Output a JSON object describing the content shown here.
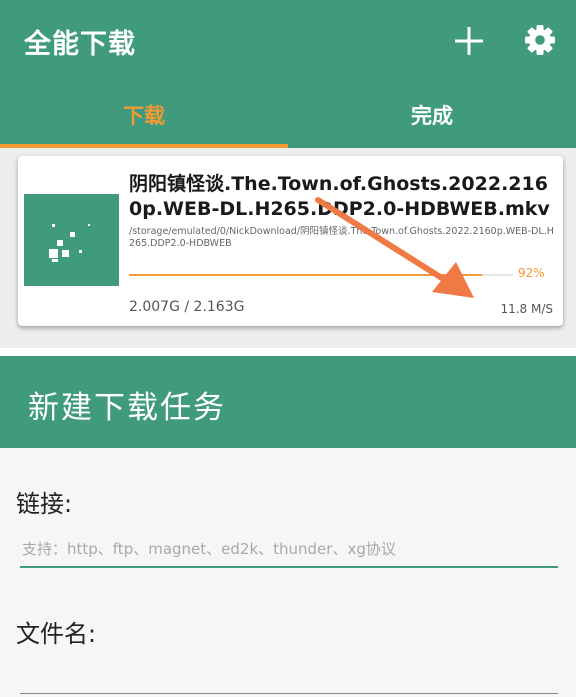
{
  "app": {
    "title": "全能下载"
  },
  "tabs": [
    {
      "label": "下载",
      "active": true
    },
    {
      "label": "完成",
      "active": false
    }
  ],
  "download_item": {
    "file_name": "阴阳镇怪谈.The.Town.of.Ghosts.2022.2160p.WEB-DL.H265.DDP2.0-HDBWEB.mkv",
    "path": "/storage/emulated/0/NickDownload/阴阳镇怪谈.The.Town.of.Ghosts.2022.2160p.WEB-DL.H265.DDP2.0-HDBWEB",
    "percent_label": "92%",
    "progress": 0.92,
    "size_label": "2.007G / 2.163G",
    "speed_label": "11.8 M/S"
  },
  "new_task": {
    "title": "新建下载任务",
    "link_label": "链接:",
    "link_placeholder": "支持：http、ftp、magnet、ed2k、thunder、xg协议",
    "link_value": "",
    "filename_label": "文件名:",
    "filename_value": ""
  },
  "colors": {
    "primary": "#3f9a7e",
    "accent": "#f39a34",
    "annotation_arrow": "#f07a45"
  },
  "icons": {
    "add": "add-icon",
    "settings": "gear-icon",
    "thumbnail": "video-file-icon"
  }
}
